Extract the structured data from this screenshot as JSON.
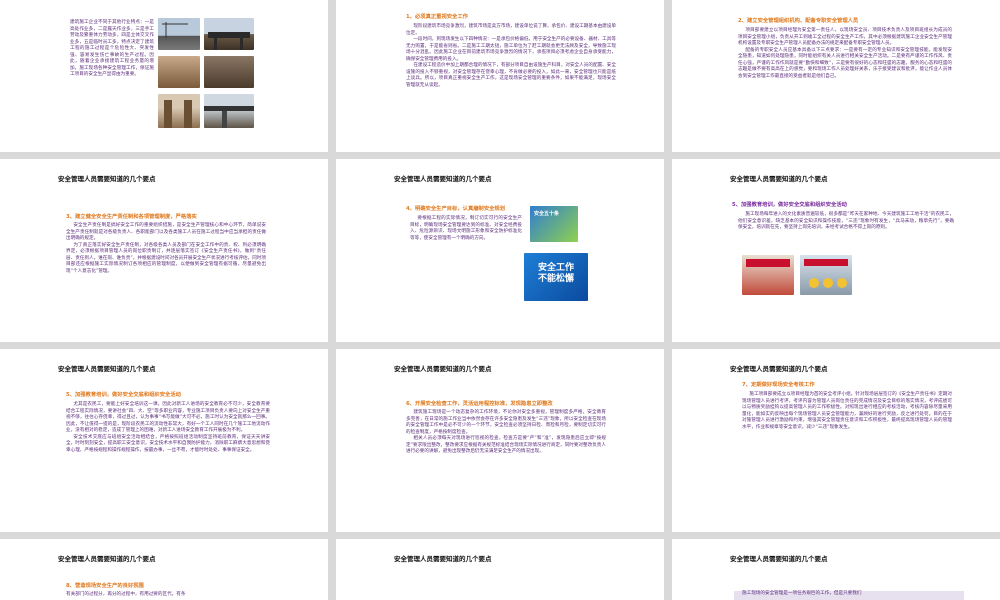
{
  "title": "安全管理人员需要知道的几个要点",
  "slides": {
    "s1": {
      "body": "建筑施工企业不同于其他行业特点：一是高处作业多，二是露天作业多，三是手工劳动及繁重体力劳动多，四是立体交叉作业多，五是临时员工多，特点决定了建筑工程的施工过程是个危险性大、突发性强、容易发生伤亡事故的生产过程。因此，随着企业承接建筑工程业务量的增加，施工现场各种安全管理工作，保证施工项目的安全生产显得由为重要。"
    },
    "s2": {
      "heading": "1、必须真正重视安全工作",
      "body": [
        "现阶段建筑市场竞争激烈，建筑市场是卖方市场，建设单位说了算，承包价、建设工期基本由建设单位定。",
        "一段时间，到现场发生以下四种情况：一是承包价格偏低，用于安全生产的必要设备、器材、工具等无力购置，于是能省则省。二是施工工期太短，施工单位为了赶工期就会更无法顾及安全，导致施工现场十分混乱。因此施工企业在目前建筑市场竞争激烈的情况下，承揽项目必须考虑企业自身承受能力，确保安全管理费用的投入。",
        "在建设工程造价中加上期都合理的情况下，有部分项目自由设施生产科目，对安全人员的配置、安全设施的投入不够重视，对安全管理存在侥幸心理，不肯做必要的投入，如此一来，安全管理也只能是纸上谈兵。所以，项目真正重视安全生产工作，这是现场安全管理的重要条件，如果不能满足，现场安全管理就无从谈起。"
      ]
    },
    "s3": {
      "heading": "2、建立安全管理组织机构、配备专职安全管理人员",
      "body": [
        "项目部要建立以项目经理为安全第一责任人，以现场安全员、项目技术负责人及项目班组长为成员的项目安全管理小组，负责从开工到竣工全过程的安全生产工作，其中必须根据建筑施工企业安全生产管理机构设置及专职安全生产管理人员配备办法的规定来配备专职安全管理人员。",
        "配备的专职安全人员应基本具备以下三点要求：一是要有一定的专业知识和安全管理技能，能发现安全隐患，知道如何处理隐患，同时能组织有关人员进行相关安全生产活动。二是要有严谨的工作作风、责任心强，严谨的工作作风就是要“勤快和细致”，三是要有很好的心态和旺盛的志趣，服务的心态和旺盛的志趣是做不要有高高在上的感觉，要和现场工作人员处理好关系，乐于接受建议和批评，能让作业人员体会到安全管理工作最直接的受益者就是他们自己。"
      ]
    },
    "s4": {
      "heading": "3、建立健全安全生产责任制和各项管理制度，严格落实",
      "body": [
        "安全生产责任制是搞好安全工作的重要组织措施，是安全生产管理核心和中心环节，简单说安全生产责任制就是对各级负责人、各职能部门以及各类施工人员在施工过程当中应当承担的责任做出明确的规定。",
        "为了真正落实好安全生产责任制，对各级各类人员及部门在安全工作中的责、权、利必须明确界定，必须根据项目管理人员的岗位职责制订，并逐层落实签订《安全生产责任书》，做到“责任层、责任到人，谁在岗、谁负责”，并根据建设时间对各员开展安全生产状况进行考核评估，同时项目部还应根据施工实际情况制订各项相应的管理制度，以便做到安全管理有据可循，尽量避免出现“个人意志化”管理。"
      ]
    },
    "s5": {
      "heading": "4、明确安全生产目标，认真编制安全规划",
      "body": "要根据工程的实际情况，制订切实可行的安全生产目标，明确现场安全管理要达到的标准、对安全经费投入、危险源辨识、现场文明施工形象和安全防护标准化等等，使安全管理有一个明确的方向。",
      "poster1": "安全五十条",
      "poster2": "安全工作",
      "poster3": "不能松懈"
    },
    "s6": {
      "heading": "5、加强教育培训，做好安全交底和组织安全活动",
      "body": "施工现场每年进入的文化素质普遍较低，很多都是“昨天在家种地、今天建筑施工工地干活”的农民工，他们安全意识差，缺乏基本的安全知识和操作技能，“三违”现象时有发生，“兵马未动，粮草先行”，要确保安全，培训就在先，要坚持上岗先培训，未经考试合格不得上岗的原则。"
    },
    "s7": {
      "heading": "5、加强教育培训，做好安全交底和组织安全活动",
      "body": [
        "尤其是农民工，要能上好安全培训这一课。因此对新工人进场的安全教育必不可少，安全教育要结合工程实际情况，要讲社会“四、大、空”等多职业内容，专业施工项目负责人要向上对安全生产重视不够，往往心存侥幸，得过且过，认为事事“书写能做”大可不必，施工时认为安全就那么一回事。因此，不让值得一提的是，现阶段农民工的流动性非常大，有好一个工人同时在几个施工工地流动作业，没有相对的稳定，造成了管理上的困难，对新工人进场安全教育工作开展极为不利。",
        "安全技术交底应与班组安全活动相结合，严格按照班组活动制度坚持班前教育，保证天天讲安全，时时刻刻安全，提高职工安全意识，安全技术水平和自我防护能力，消除职工麻痹大意思想和侥幸心理，严格按规程和操作规程操作，按最办事，一丝不苟，才能时时处处、事事保证安全。"
      ]
    },
    "s8": {
      "heading": "6、开展安全检查工作，灵活运用程控标准，发现隐患立即整改",
      "body": [
        "建筑施工现场是一个动态复杂的工作环境，不论你对安全多重视，管理制度多严格，安全教育多完善，在日常的施工作业当中依然会存在许多安全隐患及发生“三违”现象，所以安全检查在现场的安全管理工作中是必不可少的一个环节，安全检查必须坚持日检、周检和月检，要制定切实可行的检查制度，严格按制度检查。",
        "相关人员必须每天对现场进行巡视的检查，检查方是要“严”和“准”，发现隐患后应立即“按规定”要求限出整改，整改要求应根据有关规范标准结合现场实际情况进行商定，同时要对整改负责人进行必要的讲解，避免出现整改后仍无法满足安全生产的情况出现。"
      ]
    },
    "s9": {
      "heading": "7、定期做好现场安全考核工作",
      "body": "施工项目部要成立以项目经理为首的安全考评小组，针对现场层层签订的《安全生产责任书》定期对现场管理人员进行考评，考评内容为管理人员岗位责任的完成情况及安全目标的落实情况，考评成绩可以与物质奖励挂钩以提高管理人员的工作积极性。对照现出进行相应的考核活动，考核内容除尽量采用量化，能如实的反映出每个现场管理人员安全管理能力，兼顾好的进行奖励，反之进行处罚。目的在于对施管理人员进行激励和约束，增强其安全管理责任意识和工作积极性，最终提高现场管理人员的管理水平，作业和规章等安全意识，减少“三违”现象发生。"
    },
    "s10": {
      "heading": "8、营造现场安全生产的良好氛围",
      "body": "有关部门的过程分，再分的过程中，有用过要的区代，有条"
    },
    "s12": {
      "body": "施工现场的安全管理是一项任务艰巨的工作，但是只要我们"
    }
  },
  "colors": {
    "orange": "#e07a1f",
    "purple": "#7b2fa0",
    "text": "#5a2b7a",
    "background": "#d9d9d9"
  }
}
